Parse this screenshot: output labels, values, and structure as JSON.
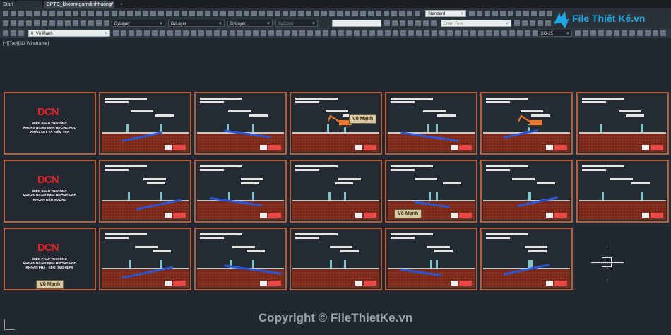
{
  "tabs": {
    "start": "Start",
    "document": "BPTC_khoanngamdinhhuong*",
    "close": "×",
    "new": "+"
  },
  "toolbar": {
    "style_combo": "Standard",
    "search_placeholder": "Enter Text",
    "color_combo": "ByLayer",
    "linetype_combo": "ByLayer",
    "lineweight_combo": "ByLayer",
    "plotstyle_combo": "ByColor",
    "dimstyle_combo": "ISO-25",
    "layer_combo": "Võ Mạnh",
    "layer_number": "0"
  },
  "brand": {
    "logo": "File Thiết Kế.vn"
  },
  "viewport": {
    "label": "[−][Top][2D Wireframe]"
  },
  "titles": [
    {
      "logo": "DCN",
      "line1": "BIỆN PHÁP THI CÔNG",
      "line2": "KHOAN NGẦM ĐỊNH HƯỚNG HDD",
      "line3": "KHẢO SÁT VÀ KIỂM TRA"
    },
    {
      "logo": "DCN",
      "line1": "BIỆN PHÁP THI CÔNG",
      "line2": "KHOAN NGẦM ĐỊNH HƯỚNG HDD",
      "line3": "KHOAN DẪN HƯỚNG"
    },
    {
      "logo": "DCN",
      "line1": "BIỆN PHÁP THI CÔNG",
      "line2": "KHOAN NGẦM ĐỊNH HƯỚNG HDD",
      "line3": "KHOAN PHÁ - KÉO ỐNG HDPE"
    }
  ],
  "watermark_label": "Võ Mạnh",
  "copyright": "Copyright © FileThietKe.vn"
}
